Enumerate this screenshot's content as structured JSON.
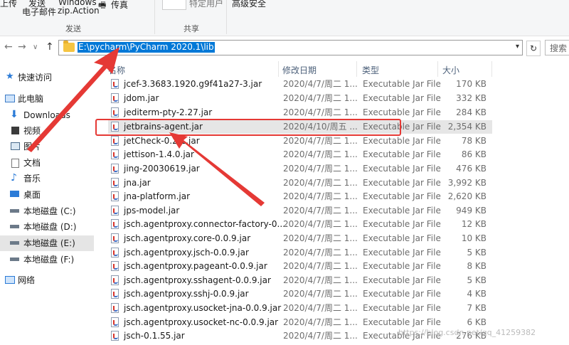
{
  "ribbon": {
    "item1": "上传",
    "item2": "发送",
    "item3": "电子邮件",
    "item4": "Windows",
    "item5": "zip.Action",
    "item6": "传真",
    "item7": "特定用户",
    "item8": "高级安全",
    "group_send": "发送",
    "group_share": "共享"
  },
  "address": {
    "path": "E:\\pycharm\\PyCharm 2020.1\\lib",
    "search_placeholder": "搜索"
  },
  "nav": {
    "back": "←",
    "forward": "→",
    "dropdown": "∨",
    "up": "↑",
    "refresh": "↻"
  },
  "sidebar": {
    "items": [
      {
        "label": "快速访问"
      },
      {
        "label": "此电脑"
      },
      {
        "label": "Downloads"
      },
      {
        "label": "视频"
      },
      {
        "label": "图片"
      },
      {
        "label": "文档"
      },
      {
        "label": "音乐"
      },
      {
        "label": "桌面"
      },
      {
        "label": "本地磁盘 (C:)"
      },
      {
        "label": "本地磁盘 (D:)"
      },
      {
        "label": "本地磁盘 (E:)"
      },
      {
        "label": "本地磁盘 (F:)"
      },
      {
        "label": "网络"
      }
    ]
  },
  "columns": {
    "name": "名称",
    "date": "修改日期",
    "type": "类型",
    "size": "大小"
  },
  "files": [
    {
      "name": "jcef-3.3683.1920.g9f41a27-3.jar",
      "date": "2020/4/7/周二 1...",
      "type": "Executable Jar File",
      "size": "170 KB"
    },
    {
      "name": "jdom.jar",
      "date": "2020/4/7/周二 1...",
      "type": "Executable Jar File",
      "size": "332 KB"
    },
    {
      "name": "jediterm-pty-2.27.jar",
      "date": "2020/4/7/周二 1...",
      "type": "Executable Jar File",
      "size": "284 KB"
    },
    {
      "name": "jetbrains-agent.jar",
      "date": "2020/4/10/周五 ...",
      "type": "Executable Jar File",
      "size": "2,354 KB"
    },
    {
      "name": "jetCheck-0.2.1.jar",
      "date": "2020/4/7/周二 1...",
      "type": "Executable Jar File",
      "size": "78 KB"
    },
    {
      "name": "jettison-1.4.0.jar",
      "date": "2020/4/7/周二 1...",
      "type": "Executable Jar File",
      "size": "86 KB"
    },
    {
      "name": "jing-20030619.jar",
      "date": "2020/4/7/周二 1...",
      "type": "Executable Jar File",
      "size": "476 KB"
    },
    {
      "name": "jna.jar",
      "date": "2020/4/7/周二 1...",
      "type": "Executable Jar File",
      "size": "3,992 KB"
    },
    {
      "name": "jna-platform.jar",
      "date": "2020/4/7/周二 1...",
      "type": "Executable Jar File",
      "size": "2,620 KB"
    },
    {
      "name": "jps-model.jar",
      "date": "2020/4/7/周二 1...",
      "type": "Executable Jar File",
      "size": "949 KB"
    },
    {
      "name": "jsch.agentproxy.connector-factory-0....",
      "date": "2020/4/7/周二 1...",
      "type": "Executable Jar File",
      "size": "12 KB"
    },
    {
      "name": "jsch.agentproxy.core-0.0.9.jar",
      "date": "2020/4/7/周二 1...",
      "type": "Executable Jar File",
      "size": "10 KB"
    },
    {
      "name": "jsch.agentproxy.jsch-0.0.9.jar",
      "date": "2020/4/7/周二 1...",
      "type": "Executable Jar File",
      "size": "5 KB"
    },
    {
      "name": "jsch.agentproxy.pageant-0.0.9.jar",
      "date": "2020/4/7/周二 1...",
      "type": "Executable Jar File",
      "size": "8 KB"
    },
    {
      "name": "jsch.agentproxy.sshagent-0.0.9.jar",
      "date": "2020/4/7/周二 1...",
      "type": "Executable Jar File",
      "size": "5 KB"
    },
    {
      "name": "jsch.agentproxy.sshj-0.0.9.jar",
      "date": "2020/4/7/周二 1...",
      "type": "Executable Jar File",
      "size": "4 KB"
    },
    {
      "name": "jsch.agentproxy.usocket-jna-0.0.9.jar",
      "date": "2020/4/7/周二 1...",
      "type": "Executable Jar File",
      "size": "7 KB"
    },
    {
      "name": "jsch.agentproxy.usocket-nc-0.0.9.jar",
      "date": "2020/4/7/周二 1...",
      "type": "Executable Jar File",
      "size": "6 KB"
    },
    {
      "name": "jsch-0.1.55.jar",
      "date": "2020/4/7/周二 1...",
      "type": "Executable Jar File",
      "size": "276 KB"
    }
  ],
  "watermark": "https://blog.csdn.net/qq_41259382",
  "colors": {
    "selection": "#0078d7",
    "annotation": "#e53935"
  }
}
